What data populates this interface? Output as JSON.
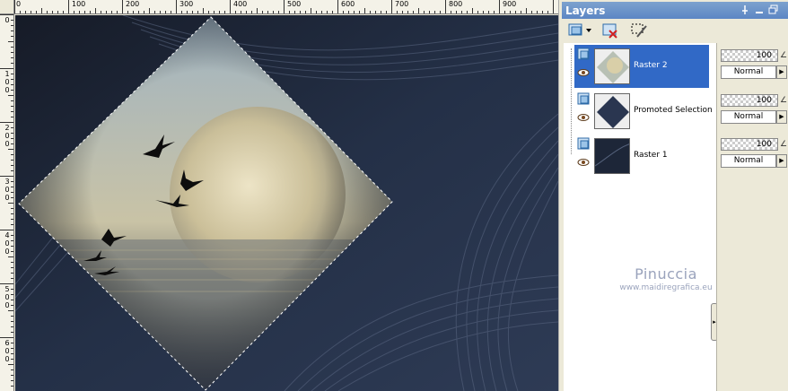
{
  "rulers": {
    "horizontal_labels": [
      "0",
      "100",
      "200",
      "300",
      "400",
      "500",
      "600",
      "700",
      "800",
      "900"
    ],
    "vertical_labels": [
      "0",
      "100",
      "200",
      "300",
      "400",
      "500",
      "600"
    ]
  },
  "image": {
    "description_colors": {
      "background": "#1c2333",
      "moon": "#d8cfb0",
      "selection": "#ffffff"
    }
  },
  "layers_panel": {
    "title": "Layers",
    "pin_icon": "pin-icon",
    "minimize_icon": "minimize-icon",
    "restore_icon": "restore-icon",
    "toolbar": [
      {
        "icon": "new-layer-icon",
        "has_dropdown": true
      },
      {
        "icon": "delete-layer-icon"
      },
      {
        "icon": "selection-edit-icon"
      }
    ],
    "layers": [
      {
        "name": "Raster 2",
        "selected": true,
        "opacity": "100",
        "blend_mode": "Normal"
      },
      {
        "name": "Promoted Selection",
        "selected": false,
        "opacity": "100",
        "blend_mode": "Normal"
      },
      {
        "name": "Raster 1",
        "selected": false,
        "opacity": "100",
        "blend_mode": "Normal"
      }
    ],
    "watermark": {
      "name": "Pinuccia",
      "url": "www.maidiregrafica.eu"
    },
    "accent_color": "#3169c6"
  }
}
